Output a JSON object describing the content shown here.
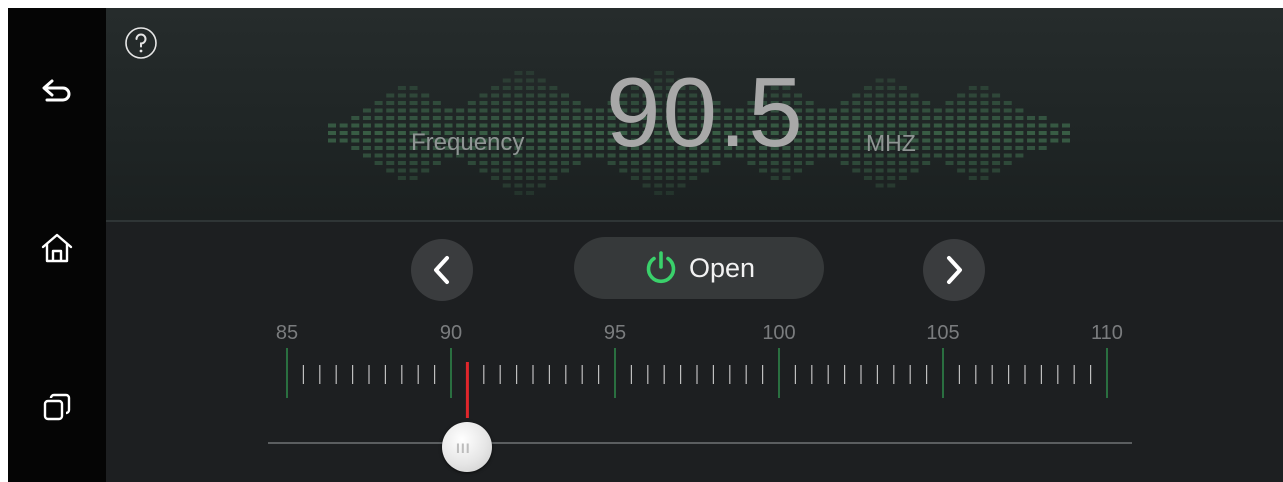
{
  "nav": {
    "back_icon": "back-arrow-icon",
    "home_icon": "home-icon",
    "recents_icon": "recent-apps-icon"
  },
  "radio": {
    "frequency_label": "Frequency",
    "frequency_value": "90.5",
    "unit": "MHZ",
    "open_label": "Open",
    "help_icon": "question-circle-icon",
    "prev_icon": "chevron-left-icon",
    "next_icon": "chevron-right-icon",
    "power_icon": "power-icon"
  },
  "scale": {
    "labels": [
      "85",
      "90",
      "95",
      "100",
      "105",
      "110"
    ],
    "min": 85,
    "max": 110,
    "current": 90.5
  },
  "colors": {
    "accent_power": "#3ad16b",
    "indicator": "#e0262b",
    "major_tick": "#2f8a4a",
    "minor_tick": "#bfbfbf",
    "eq_bars": "#4d8a5f"
  }
}
